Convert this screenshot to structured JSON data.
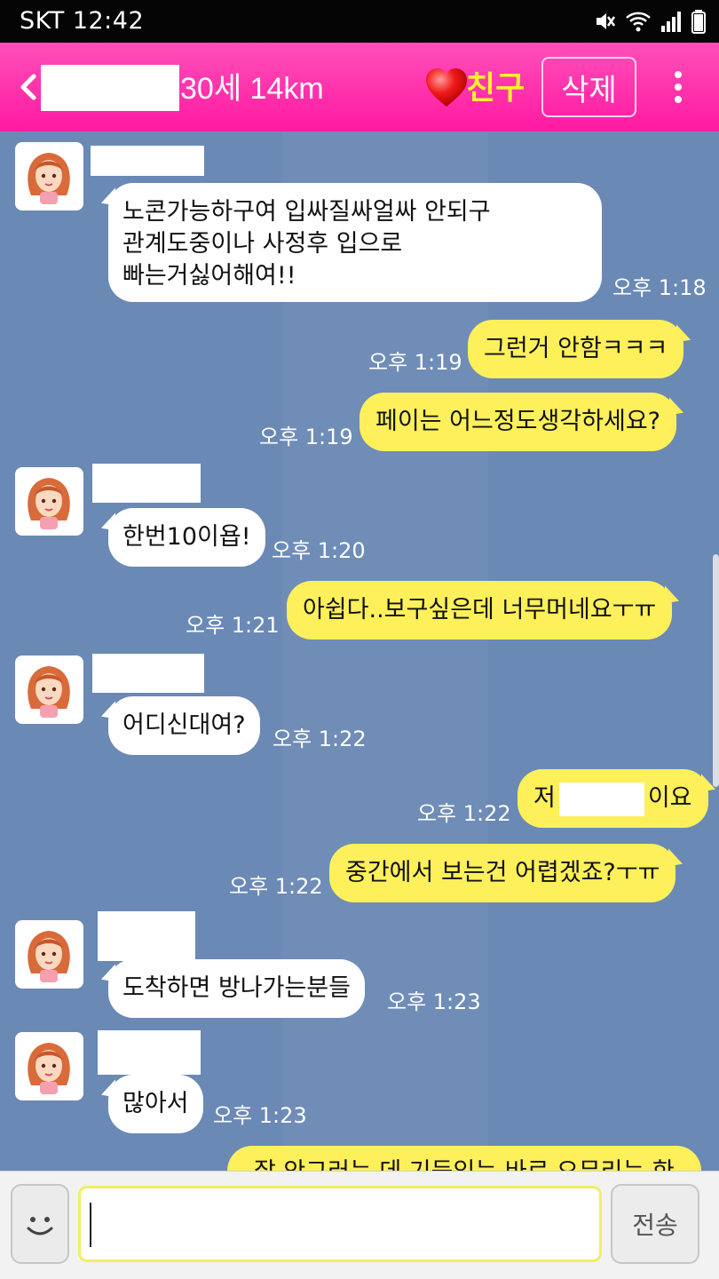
{
  "status_bar": {
    "carrier_time": "SKT 12:42"
  },
  "header": {
    "info": "30세 14km",
    "friend_label": "친구",
    "delete_label": "삭제"
  },
  "messages": [
    {
      "side": "in",
      "text": "노콘가능하구여 입싸질싸얼싸 안되구\n관계도중이나 사정후 입으로\n빠는거싫어해여!!",
      "time": "오후 1:18"
    },
    {
      "side": "out",
      "text": "그런거 안함ㅋㅋㅋ",
      "time": "오후 1:19"
    },
    {
      "side": "out",
      "text": "페이는 어느정도생각하세요?",
      "time": "오후 1:19"
    },
    {
      "side": "in",
      "text": "한번10이욥!",
      "time": "오후 1:20"
    },
    {
      "side": "out",
      "text": "아쉽다..보구싶은데 너무머네요ㅜㅠ",
      "time": "오후 1:21"
    },
    {
      "side": "in",
      "text": "어디신대여?",
      "time": "오후 1:22"
    },
    {
      "side": "out",
      "text_before": "저",
      "text_after": "이요",
      "time": "오후 1:22"
    },
    {
      "side": "out",
      "text": "중간에서 보는건 어렵겠죠?ㅜㅠ",
      "time": "오후 1:22"
    },
    {
      "side": "in",
      "text": "도착하면 방나가는분들",
      "time": "오후 1:23"
    },
    {
      "side": "in",
      "text": "많아서",
      "time": "오후 1:23"
    },
    {
      "side": "out",
      "text": "잘 안그러는 데 기둥있는 바로 오무리는 한"
    }
  ],
  "input": {
    "value": "",
    "send_label": "전송"
  },
  "colors": {
    "header": "#ff2aa8",
    "chat_bg": "#6a89b5",
    "out_bubble": "#fdf05a",
    "in_bubble": "#ffffff",
    "friend_label": "#ffee33"
  },
  "icons": [
    "back-icon",
    "heart-icon",
    "more-icon",
    "emoji-icon",
    "mute-icon",
    "wifi-icon",
    "signal-icon",
    "battery-icon"
  ]
}
